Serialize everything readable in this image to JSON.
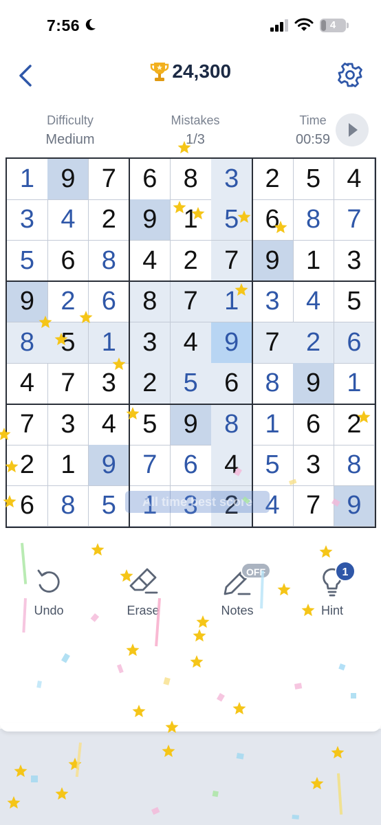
{
  "status_bar": {
    "time": "7:56",
    "battery_level": "4"
  },
  "header": {
    "score": "24,300"
  },
  "info": {
    "difficulty_label": "Difficulty",
    "difficulty_value": "Medium",
    "mistakes_label": "Mistakes",
    "mistakes_value": "1/3",
    "time_label": "Time",
    "time_value": "00:59"
  },
  "board": {
    "rows": [
      [
        "1",
        "9",
        "7",
        "6",
        "8",
        "3",
        "2",
        "5",
        "4"
      ],
      [
        "3",
        "4",
        "2",
        "9",
        "1",
        "5",
        "6",
        "8",
        "7"
      ],
      [
        "5",
        "6",
        "8",
        "4",
        "2",
        "7",
        "9",
        "1",
        "3"
      ],
      [
        "9",
        "2",
        "6",
        "8",
        "7",
        "1",
        "3",
        "4",
        "5"
      ],
      [
        "8",
        "5",
        "1",
        "3",
        "4",
        "9",
        "7",
        "2",
        "6"
      ],
      [
        "4",
        "7",
        "3",
        "2",
        "5",
        "6",
        "8",
        "9",
        "1"
      ],
      [
        "7",
        "3",
        "4",
        "5",
        "9",
        "8",
        "1",
        "6",
        "2"
      ],
      [
        "2",
        "1",
        "9",
        "7",
        "6",
        "4",
        "5",
        "3",
        "8"
      ],
      [
        "6",
        "8",
        "5",
        "1",
        "3",
        "2",
        "4",
        "7",
        "9"
      ]
    ],
    "given_mask": [
      "011110010",
      "011111011",
      "010011011",
      "111110101",
      "010111010",
      "011110001",
      "111011010",
      "111101010",
      "101101110"
    ],
    "filled_mask": [
      "100001000",
      "110001011",
      "101000000",
      "011001110",
      "101001011",
      "000010101",
      "000001100",
      "001110101",
      "011110101"
    ],
    "toast_text": "All time best score"
  },
  "toolbar": {
    "undo_label": "Undo",
    "erase_label": "Erase",
    "notes_label": "Notes",
    "notes_state": "OFF",
    "hint_label": "Hint",
    "hint_count": "1"
  },
  "colors": {
    "accent": "#2f57a8",
    "given_text": "#111111",
    "highlight_light": "#e4ebf4",
    "highlight_mid": "#c7d6ea",
    "highlight_strong": "#b8d5f3",
    "star": "#f5c518"
  }
}
